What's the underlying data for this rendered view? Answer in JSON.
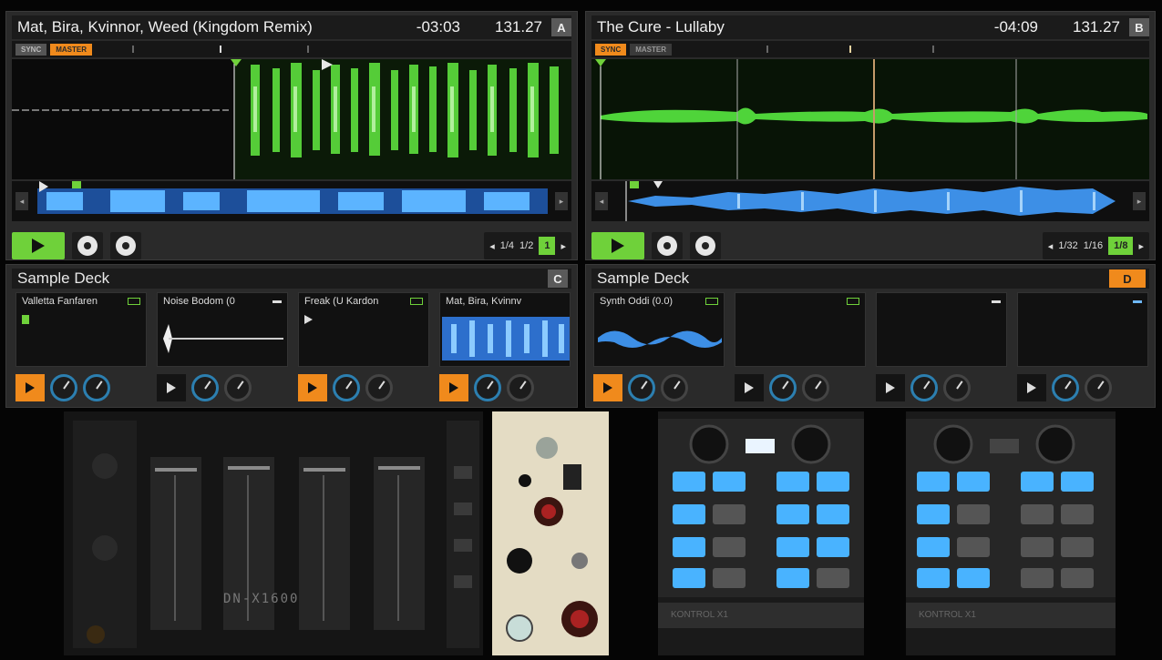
{
  "decks": {
    "a": {
      "title": "Mat, Bira, Kvinnor, Weed (Kingdom Remix)",
      "time": "-03:03",
      "bpm": "131.27",
      "letter": "A",
      "sync_label": "SYNC",
      "master_label": "MASTER",
      "loop_values": [
        "1/4",
        "1/2",
        "1"
      ]
    },
    "b": {
      "title": "The Cure - Lullaby",
      "time": "-04:09",
      "bpm": "131.27",
      "letter": "B",
      "sync_label": "SYNC",
      "master_label": "MASTER",
      "loop_values": [
        "1/32",
        "1/16",
        "1/8"
      ]
    }
  },
  "sample_decks": {
    "c": {
      "title": "Sample Deck",
      "letter": "C",
      "slots": [
        "Valletta Fanfaren",
        "Noise Bodom (0",
        "Freak (U Kardon",
        "Mat, Bira, Kvinnv"
      ]
    },
    "d": {
      "title": "Sample Deck",
      "letter": "D",
      "slots": [
        "Synth Oddi (0.0)",
        "",
        "",
        ""
      ]
    }
  },
  "hardware": {
    "mixer_model": "DN-X1600",
    "controller_labels": [
      "KONTROL X1",
      "KONTROL X1"
    ]
  },
  "colors": {
    "accent": "#f08a1c",
    "play": "#6fd13a",
    "waveform_green": "#4fd43a",
    "waveform_blue": "#3d8fe6"
  }
}
